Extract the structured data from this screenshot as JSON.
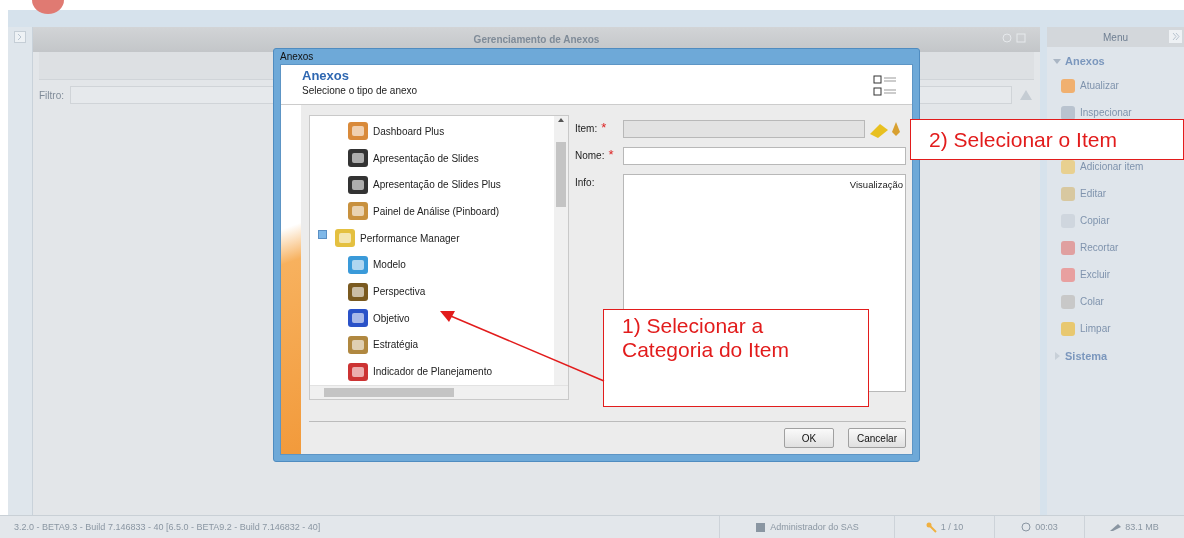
{
  "app": {
    "panel_title": "Gerenciamento de Anexos",
    "filter_label": "Filtro:"
  },
  "menu": {
    "title": "Menu",
    "sections": [
      {
        "label": "Anexos",
        "expanded": true,
        "items": [
          {
            "kind": "entry",
            "label": "Atualizar"
          },
          {
            "kind": "entry",
            "label": "Inspecionar"
          },
          {
            "kind": "covered"
          },
          {
            "kind": "entry",
            "label": "Adicionar item"
          },
          {
            "kind": "entry",
            "label": "Editar"
          },
          {
            "kind": "entry",
            "label": "Copiar"
          },
          {
            "kind": "entry",
            "label": "Recortar"
          },
          {
            "kind": "entry",
            "label": "Excluir"
          },
          {
            "kind": "entry",
            "label": "Colar"
          },
          {
            "kind": "entry",
            "label": "Limpar"
          }
        ]
      },
      {
        "label": "Sistema",
        "expanded": false
      }
    ]
  },
  "dialog": {
    "window_title": "Anexos",
    "heading": "Anexos",
    "subtitle": "Selecione o tipo de anexo",
    "tree": {
      "continued_children": [
        {
          "label": "Dashboard Plus"
        },
        {
          "label": "Apresentação de Slides"
        },
        {
          "label": "Apresentação de Slides Plus"
        },
        {
          "label": "Painel de Análise (Pinboard)"
        }
      ],
      "items": [
        {
          "label": "Performance Manager",
          "expanded": true,
          "children": [
            {
              "label": "Modelo"
            },
            {
              "label": "Perspectiva"
            },
            {
              "label": "Objetivo"
            },
            {
              "label": "Estratégia"
            },
            {
              "label": "Indicador de Planejamento"
            }
          ]
        }
      ]
    },
    "fields": {
      "item_label": "Item:",
      "name_label": "Nome:",
      "required_mark": "*",
      "info_label": "Info:",
      "preview_label": "Visualização"
    },
    "buttons": [
      "OK",
      "Cancelar"
    ]
  },
  "annotations": [
    "1) Selecionar a Categoria do Item",
    "2) Selecionar o Item"
  ],
  "status_bar": {
    "version": "3.2.0 - BETA9.3 - Build 7.146833 - 40 [6.5.0 - BETA9.2 - Build 7.146832 - 40]",
    "user": "Administrador do SAS",
    "count": "1 / 10",
    "time": "00:03",
    "memory": "83.1 MB"
  }
}
